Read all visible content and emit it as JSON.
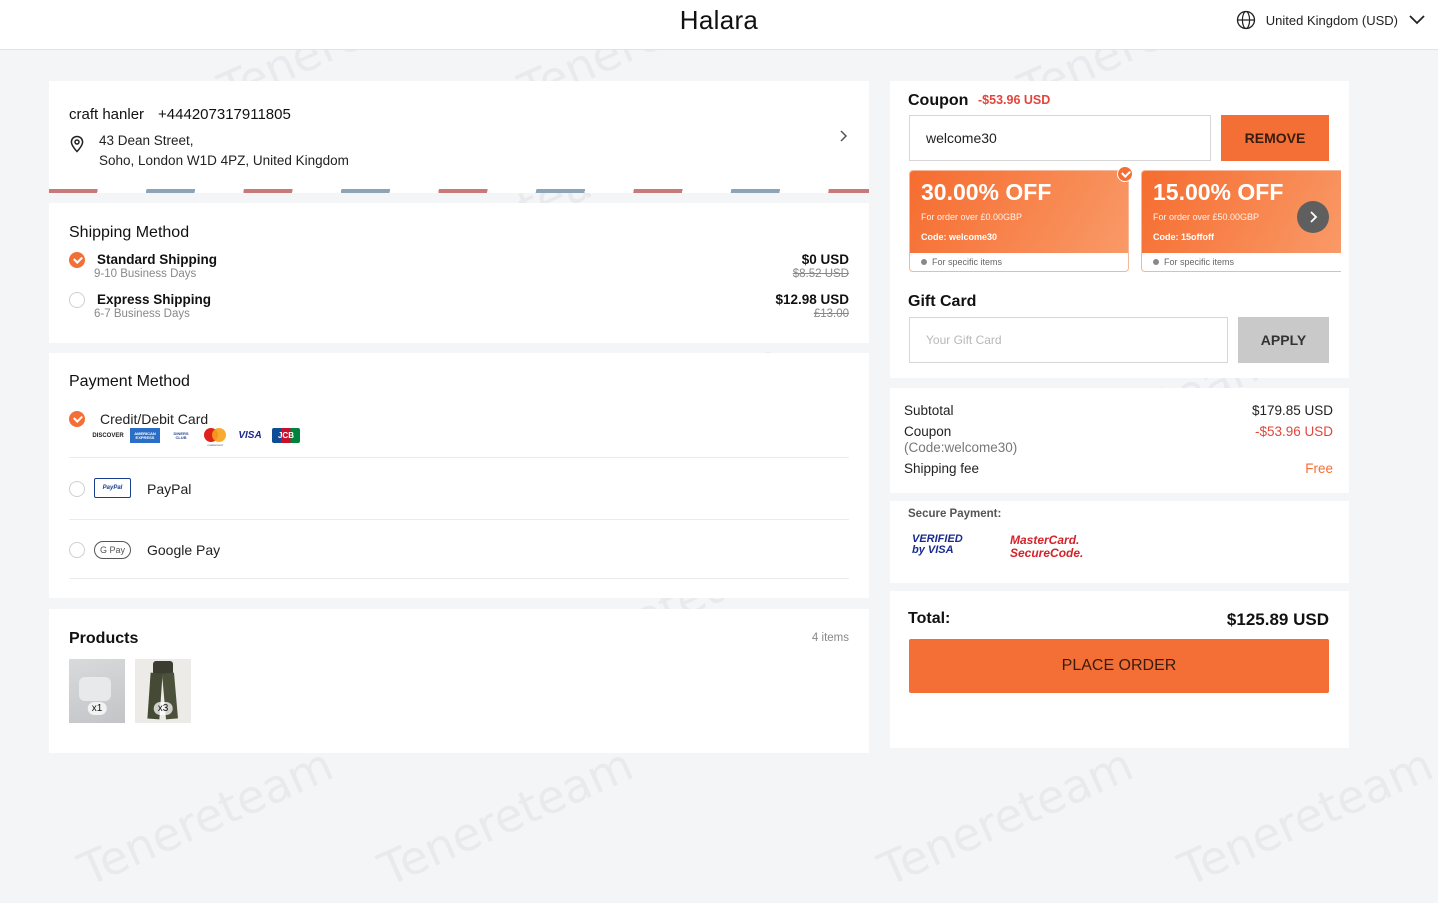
{
  "header": {
    "brand": "Halara",
    "region": "United Kingdom (USD)"
  },
  "address": {
    "name": "craft hanler",
    "phone": "+444207317911805",
    "line1": "43 Dean Street,",
    "line2": "Soho, London W1D 4PZ, United Kingdom"
  },
  "shipping": {
    "title": "Shipping Method",
    "options": [
      {
        "label": "Standard Shipping",
        "sub": "9-10 Business Days",
        "price": "$0 USD",
        "old": "$8.52 USD",
        "selected": true
      },
      {
        "label": "Express Shipping",
        "sub": "6-7 Business Days",
        "price": "$12.98 USD",
        "old": "£13.00",
        "selected": false
      }
    ]
  },
  "payment": {
    "title": "Payment Method",
    "methods": [
      {
        "label": "Credit/Debit Card",
        "selected": true
      },
      {
        "label": "PayPal",
        "selected": false
      },
      {
        "label": "Google Pay",
        "selected": false
      }
    ],
    "card_logos": [
      "DISCOVER",
      "AMERICAN EXPRESS",
      "DINERS CLUB",
      "mastercard",
      "VISA",
      "JCB"
    ],
    "paypal_logo": "PayPal",
    "gpay_logo": "G Pay"
  },
  "products": {
    "title": "Products",
    "count": "4 items",
    "items": [
      {
        "qty": "x1"
      },
      {
        "qty": "x3"
      }
    ]
  },
  "coupon": {
    "title": "Coupon",
    "discount": "-$53.96 USD",
    "input_value": "welcome30",
    "remove_label": "REMOVE",
    "tickets": [
      {
        "percent": "30.00% OFF",
        "condition": "For order over £0.00GBP",
        "code": "Code: welcome30",
        "note": "For specific items",
        "selected": true
      },
      {
        "percent": "15.00% OFF",
        "condition": "For order over £50.00GBP",
        "code": "Code: 15offoff",
        "note": "For specific items",
        "selected": false
      }
    ]
  },
  "gift_card": {
    "title": "Gift Card",
    "placeholder": "Your Gift Card",
    "apply_label": "APPLY"
  },
  "summary": {
    "subtotal_label": "Subtotal",
    "subtotal": "$179.85 USD",
    "coupon_label": "Coupon",
    "coupon_code": "(Code:welcome30)",
    "coupon_value": "-$53.96 USD",
    "shipping_label": "Shipping fee",
    "shipping_value": "Free",
    "secure_label": "Secure Payment:",
    "verified_visa": "VERIFIED by VISA",
    "mc_secure": "MasterCard. SecureCode.",
    "total_label": "Total:",
    "total": "$125.89 USD",
    "place_order": "PLACE ORDER"
  },
  "watermark": "Tenereteam",
  "colors": {
    "accent": "#f36f36",
    "discount": "#e2453c",
    "background": "#f4f5f7"
  }
}
